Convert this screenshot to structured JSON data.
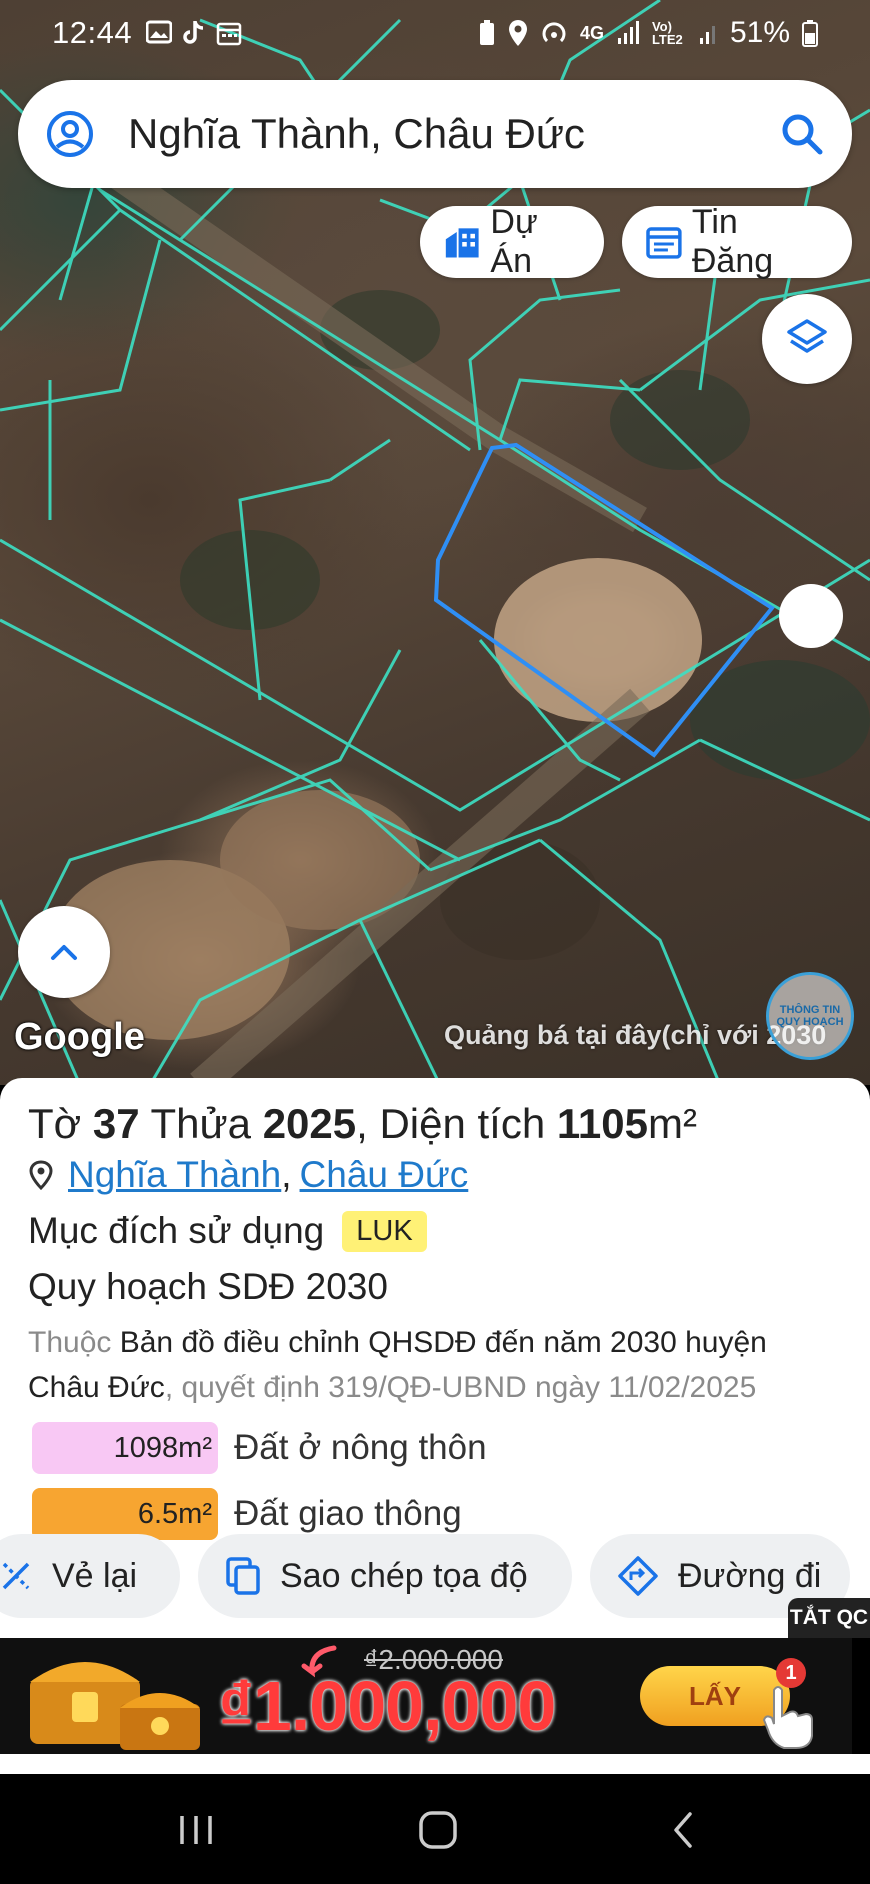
{
  "status_bar": {
    "time": "12:44",
    "network_label": "4G",
    "volte_label": "Vo) LTE2",
    "battery_percent": "51%"
  },
  "search": {
    "value": "Nghĩa Thành, Châu Đức"
  },
  "pills": {
    "du_an": "Dự Án",
    "tin_dang": "Tin Đăng"
  },
  "map": {
    "google_label": "Google",
    "promo_text": "Quảng bá tại đây(chỉ với 2030",
    "logo_text": "THÔNG TIN QUY HOẠCH"
  },
  "parcel": {
    "to_label": "Tờ",
    "to_value": "37",
    "thua_label": "Thửa",
    "thua_value": "2025",
    "area_label": ", Diện tích",
    "area_value": "1105",
    "area_unit": "m²",
    "ward": "Nghĩa Thành",
    "separator": ",",
    "district": "Châu Đức",
    "purpose_label": "Mục đích sử dụng",
    "purpose_code": "LUK",
    "plan_title": "Quy hoạch SDĐ 2030",
    "belong_label": "Thuộc",
    "belong_map": "Bản đồ điều chỉnh QHSDĐ đến năm 2030 huyện Châu Đức",
    "decision": ", quyết định 319/QĐ-UBND ngày 11/02/2025",
    "land_types": [
      {
        "area": "1098m²",
        "label": "Đất ở nông thôn",
        "color": "#f8c8f4"
      },
      {
        "area": "6.5m²",
        "label": "Đất giao thông",
        "color": "#f7a531"
      }
    ]
  },
  "actions": {
    "redraw": "Vẻ lại",
    "copy_coords": "Sao chép tọa độ",
    "directions": "Đường đi"
  },
  "ad": {
    "hide_label": "TẮT QC",
    "old_price": "₫2.000.000",
    "new_price": "₫1.000,000",
    "cta": "LẤY",
    "badge": "1"
  },
  "colors": {
    "link": "#1f7acb",
    "parcel_outline": "#2f8ff5",
    "plot_lines": "#3de0c4",
    "search_icon": "#1a73e8"
  }
}
